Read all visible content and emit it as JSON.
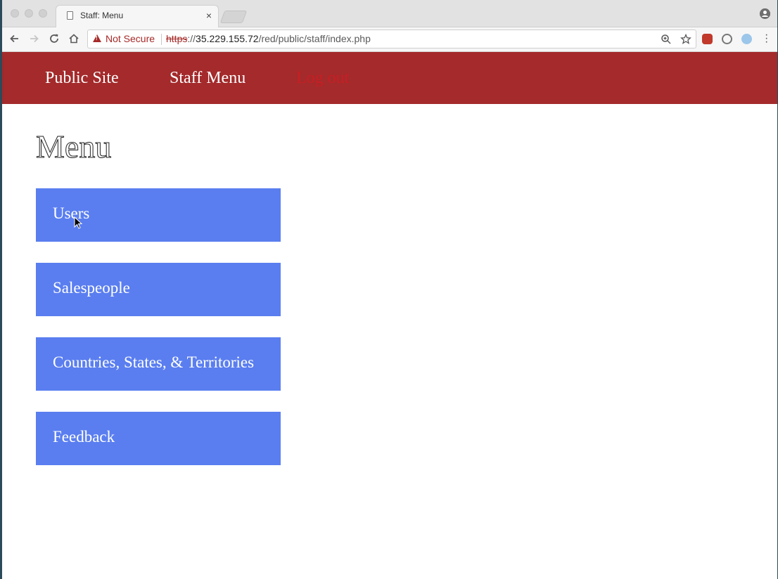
{
  "browser": {
    "tab_title": "Staff: Menu",
    "tab_close": "×",
    "security_label": "Not Secure",
    "url_scheme": "https",
    "url_sep": "://",
    "url_host": "35.229.155.72",
    "url_path": "/red/public/staff/index.php",
    "profile_icon": "person-circle-icon"
  },
  "site_nav": {
    "items": [
      {
        "label": "Public Site"
      },
      {
        "label": "Staff Menu"
      },
      {
        "label": "Log out"
      }
    ],
    "background": "#a42a2b",
    "logout_color": "#c81e24"
  },
  "main": {
    "title": "Menu",
    "buttons": [
      {
        "label": "Users"
      },
      {
        "label": "Salespeople"
      },
      {
        "label": "Countries, States, & Territories"
      },
      {
        "label": "Feedback"
      }
    ],
    "button_color": "#5a7ef0"
  }
}
